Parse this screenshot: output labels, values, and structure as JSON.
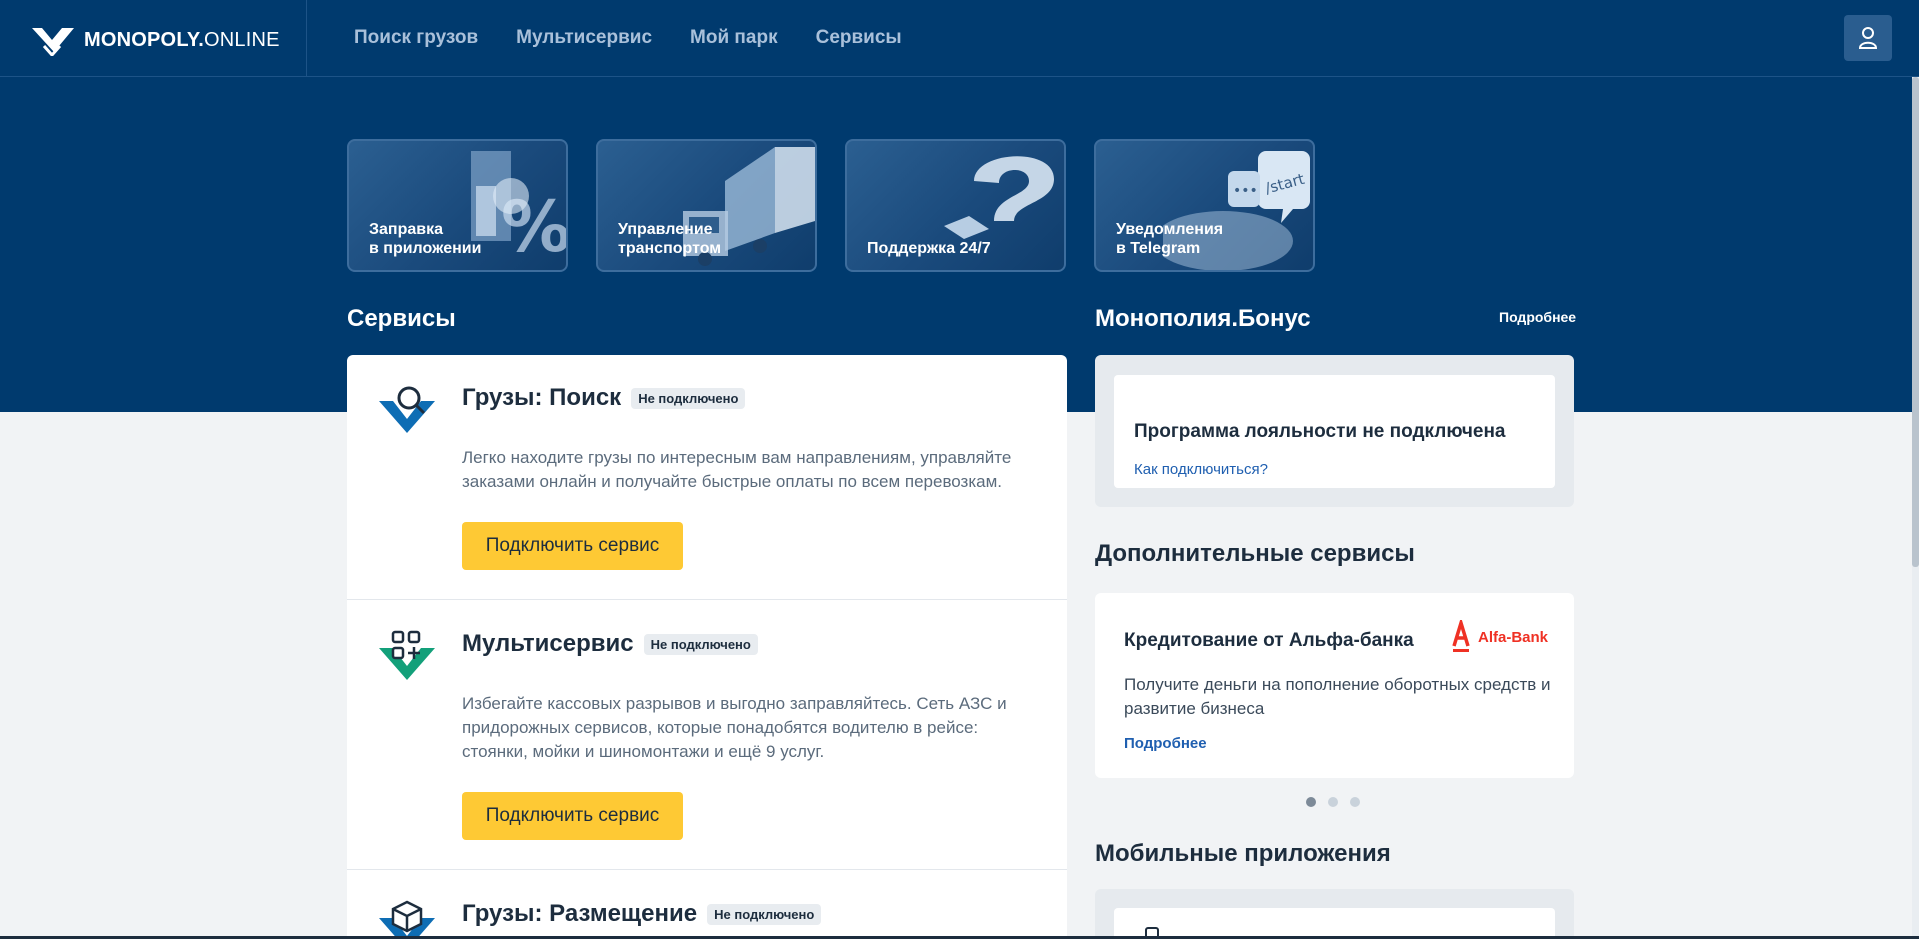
{
  "header": {
    "logo_bold": "MONOPOLY.",
    "logo_thin": "ONLINE",
    "nav": [
      {
        "label": "Поиск грузов"
      },
      {
        "label": "Мультисервис"
      },
      {
        "label": "Мой парк"
      },
      {
        "label": "Сервисы"
      }
    ],
    "user_icon": "user-icon"
  },
  "tiles": [
    {
      "label": "Заправка\nв приложении",
      "icon": "fuel-percent-illustration"
    },
    {
      "label": "Управление\nтранспортом",
      "icon": "truck-illustration"
    },
    {
      "label": "Поддержка 24/7",
      "icon": "question-mark-illustration"
    },
    {
      "label": "Уведомления\nв Telegram",
      "icon": "telegram-chat-illustration"
    }
  ],
  "services": {
    "title": "Сервисы",
    "items": [
      {
        "title": "Грузы: Поиск",
        "status": "Не подключено",
        "description": "Легко находите грузы по интересным вам направлениям, управляйте заказами онлайн и получайте быстрые оплаты по всем перевозкам.",
        "button": "Подключить сервис",
        "icon": "cargo-search-icon"
      },
      {
        "title": "Мультисервис",
        "status": "Не подключено",
        "description": "Избегайте кассовых разрывов и выгодно заправляйтесь. Сеть АЗС и придорожных сервисов, которые понадобятся водителю в рейсе: стоянки, мойки и шиномонтажи и ещё 9 услуг.",
        "button": "Подключить сервис",
        "icon": "multiservice-icon"
      },
      {
        "title": "Грузы: Размещение",
        "status": "Не подключено",
        "icon": "cargo-placement-icon"
      }
    ]
  },
  "bonus": {
    "title": "Монополия.Бонус",
    "more": "Подробнее",
    "card_title": "Программа лояльности не подключена",
    "card_link": "Как подключиться?"
  },
  "extra": {
    "title": "Дополнительные сервисы",
    "card_title": "Кредитование от Альфа-банка",
    "logo_text": "Alfa-Bank",
    "description": "Получите деньги на пополнение оборотных средств и развитие бизнеса",
    "more": "Подробнее",
    "active_slide": 1,
    "slides": 3
  },
  "mobile": {
    "title": "Мобильные приложения"
  },
  "colors": {
    "brand_blue": "#003a6e",
    "accent_yellow": "#fec934",
    "alfa_red": "#ef3124",
    "link_blue": "#1f5fb0"
  }
}
